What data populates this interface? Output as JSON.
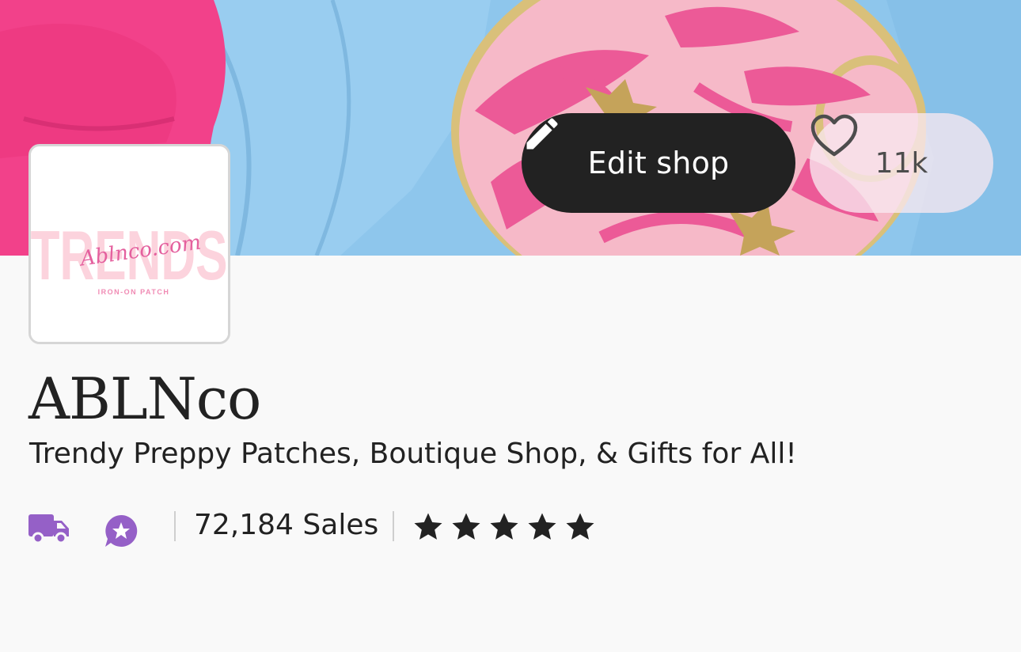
{
  "header": {
    "edit_shop_label": "Edit shop",
    "favorite_count": "11k"
  },
  "logo": {
    "big_text": "TRENDS",
    "script_text": "Ablnco.com",
    "sub_text": "IRON-ON PATCH"
  },
  "shop": {
    "name": "ABLNco",
    "tagline": "Trendy Preppy Patches, Boutique Shop, & Gifts for All!",
    "sales": "72,184 Sales",
    "rating": 5,
    "rating_max": 5
  },
  "icons": {
    "edit": "pencil-icon",
    "favorite": "heart-icon",
    "shipping": "truck-icon",
    "star_seller": "star-badge-icon",
    "rating": "star-icon"
  },
  "colors": {
    "button_dark": "#222222",
    "badge_purple": "#9560c7",
    "logo_pink": "#fcd3dd",
    "logo_script": "#e4609e",
    "page_bg": "#f9f9f9"
  }
}
